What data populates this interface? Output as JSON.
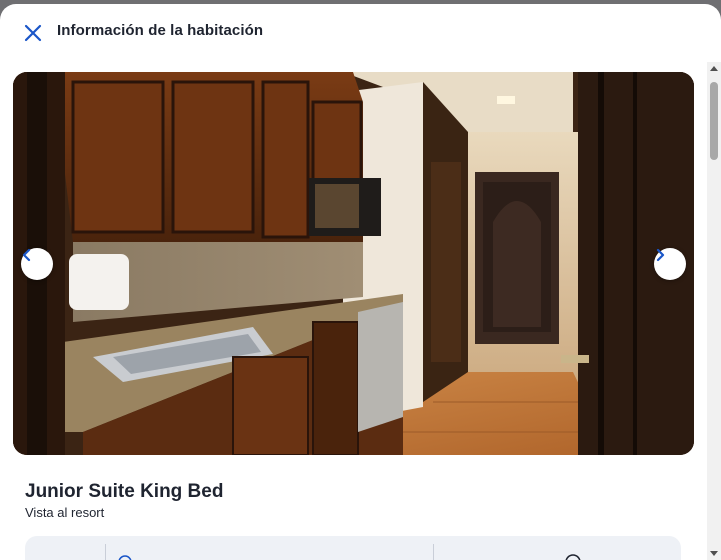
{
  "dialog": {
    "title": "Información de la habitación",
    "close_icon": "close-icon"
  },
  "gallery": {
    "prev_icon": "chevron-left-icon",
    "next_icon": "chevron-right-icon",
    "photo": "hotel-room-kitchenette-photo"
  },
  "room": {
    "name": "Junior Suite King Bed",
    "view": "Vista al resort"
  },
  "colors": {
    "accent": "#1a56c8",
    "text": "#1f2430",
    "strip_bg": "#eef1f6"
  }
}
